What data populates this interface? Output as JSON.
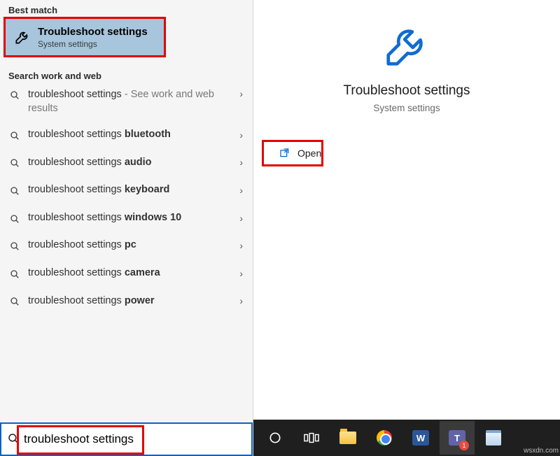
{
  "left": {
    "best_match_label": "Best match",
    "best_match": {
      "title": "Troubleshoot settings",
      "subtitle": "System settings"
    },
    "secondary_label": "Search work and web",
    "results": [
      {
        "prefix": "troubleshoot settings",
        "bold": "",
        "hint": " - See work and web results",
        "tall": true
      },
      {
        "prefix": "troubleshoot settings ",
        "bold": "bluetooth",
        "hint": ""
      },
      {
        "prefix": "troubleshoot settings ",
        "bold": "audio",
        "hint": ""
      },
      {
        "prefix": "troubleshoot settings ",
        "bold": "keyboard",
        "hint": ""
      },
      {
        "prefix": "troubleshoot settings ",
        "bold": "windows 10",
        "hint": ""
      },
      {
        "prefix": "troubleshoot settings ",
        "bold": "pc",
        "hint": ""
      },
      {
        "prefix": "troubleshoot settings ",
        "bold": "camera",
        "hint": ""
      },
      {
        "prefix": "troubleshoot settings ",
        "bold": "power",
        "hint": ""
      }
    ],
    "search_value": "troubleshoot settings"
  },
  "right": {
    "title": "Troubleshoot settings",
    "subtitle": "System settings",
    "open_label": "Open"
  },
  "taskbar": {
    "items": [
      {
        "name": "cortana-icon"
      },
      {
        "name": "task-view-icon"
      },
      {
        "name": "file-explorer-icon"
      },
      {
        "name": "chrome-icon"
      },
      {
        "name": "word-icon",
        "glyph": "W"
      },
      {
        "name": "teams-icon",
        "glyph": "T",
        "badge": "1"
      },
      {
        "name": "notepad-icon"
      }
    ]
  },
  "watermark": "wsxdn.com"
}
